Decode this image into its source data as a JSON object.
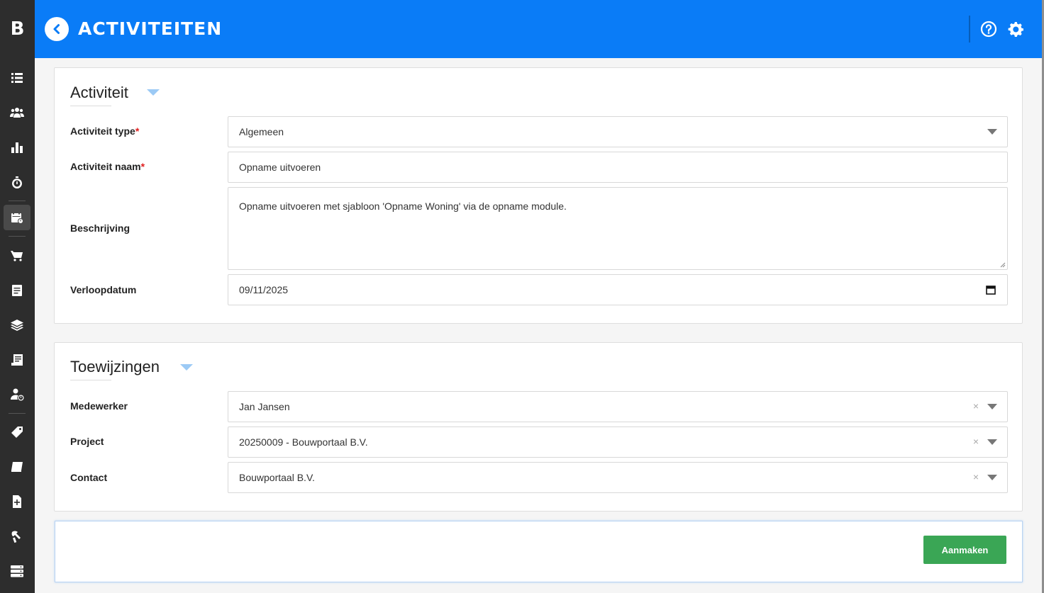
{
  "app": {
    "logo_letter": "B",
    "title": "ACTIVITEITEN",
    "accent_color": "#0a7cf7",
    "sidebar_color": "#2d2d2d"
  },
  "sidebar": {
    "items": [
      {
        "icon": "list-icon"
      },
      {
        "icon": "users-icon"
      },
      {
        "icon": "bar-chart-icon"
      },
      {
        "icon": "stopwatch-icon"
      },
      {
        "icon": "calendar-clock-icon",
        "active": true
      },
      {
        "icon": "cart-icon"
      },
      {
        "icon": "document-icon"
      },
      {
        "icon": "layers-icon"
      },
      {
        "icon": "cash-register-icon"
      },
      {
        "icon": "user-clock-icon"
      },
      {
        "icon": "tag-icon"
      },
      {
        "icon": "book-icon"
      },
      {
        "icon": "file-plus-icon"
      },
      {
        "icon": "tools-icon"
      },
      {
        "icon": "server-icon"
      }
    ]
  },
  "activiteit": {
    "heading": "Activiteit",
    "type_label": "Activiteit type",
    "type_value": "Algemeen",
    "naam_label": "Activiteit naam",
    "naam_value": "Opname uitvoeren",
    "beschrijving_label": "Beschrijving",
    "beschrijving_value": "Opname uitvoeren met sjabloon 'Opname Woning' via de opname module.",
    "verloopdatum_label": "Verloopdatum",
    "verloopdatum_value": "09/11/2025",
    "required_marker": "*"
  },
  "toewijzingen": {
    "heading": "Toewijzingen",
    "medewerker_label": "Medewerker",
    "medewerker_value": "Jan Jansen",
    "project_label": "Project",
    "project_value": "20250009 - Bouwportaal B.V.",
    "contact_label": "Contact",
    "contact_value": "Bouwportaal B.V.",
    "clear_glyph": "×"
  },
  "actions": {
    "create_label": "Aanmaken",
    "create_color": "#3aa655"
  }
}
